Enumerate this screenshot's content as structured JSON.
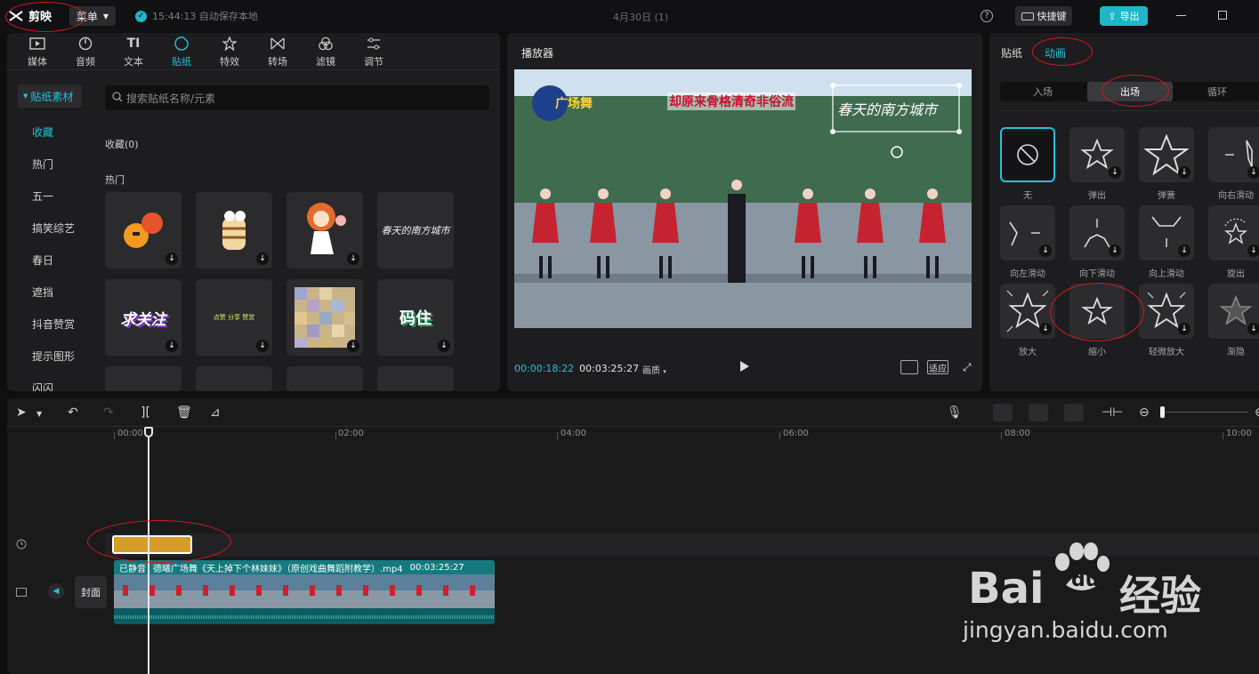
{
  "topbar": {
    "logo_text": "剪映",
    "menu_label": "菜单",
    "save_status": "15:44:13 自动保存本地",
    "doc_title": "4月30日 (1)",
    "shortcut_label": "快捷键",
    "export_label": "导出"
  },
  "media": {
    "tabs": [
      {
        "label": "媒体",
        "icon": "media-icon"
      },
      {
        "label": "音频",
        "icon": "audio-icon"
      },
      {
        "label": "文本",
        "icon": "text-icon"
      },
      {
        "label": "贴纸",
        "icon": "sticker-icon"
      },
      {
        "label": "特效",
        "icon": "effects-icon"
      },
      {
        "label": "转场",
        "icon": "transition-icon"
      },
      {
        "label": "滤镜",
        "icon": "filter-icon"
      },
      {
        "label": "调节",
        "icon": "adjust-icon"
      }
    ],
    "category_header": "贴纸素材",
    "side_items": [
      "收藏",
      "热门",
      "五一",
      "搞笑综艺",
      "春日",
      "遮挡",
      "抖音赞赏",
      "提示图形",
      "闪闪"
    ],
    "search_placeholder": "搜索贴纸名称/元素",
    "favorites_label": "收藏(0)",
    "hot_label": "热门",
    "sticker_texts": [
      "春天的南方城市",
      "求关注",
      "点赞 分享 赞赏",
      "码住"
    ]
  },
  "player": {
    "title": "播放器",
    "current_time": "00:00:18:22",
    "total_time": "00:03:25:27",
    "quality_label": "画质",
    "fit_label": "适应",
    "video_banner": "却原来骨格清奇非俗流",
    "video_sticker": "春天的南方城市",
    "video_logo": "广场舞"
  },
  "properties": {
    "tabs": [
      "贴纸",
      "动画"
    ],
    "segments": [
      "入场",
      "出场",
      "循环"
    ],
    "animations": [
      {
        "label": "无",
        "icon": "none-icon"
      },
      {
        "label": "弹出",
        "icon": "star-icon"
      },
      {
        "label": "弹簧",
        "icon": "star-icon"
      },
      {
        "label": "向右滑动",
        "icon": "star-icon"
      },
      {
        "label": "向左滑动",
        "icon": "star-icon"
      },
      {
        "label": "向下滑动",
        "icon": "star-icon"
      },
      {
        "label": "向上滑动",
        "icon": "star-icon"
      },
      {
        "label": "旋出",
        "icon": "star-icon"
      },
      {
        "label": "放大",
        "icon": "star-icon"
      },
      {
        "label": "缩小",
        "icon": "star-icon"
      },
      {
        "label": "轻微放大",
        "icon": "star-icon"
      },
      {
        "label": "渐隐",
        "icon": "star-icon"
      }
    ]
  },
  "timeline": {
    "ruler": [
      "00:00",
      "02:00",
      "04:00",
      "06:00",
      "08:00",
      "10:00"
    ],
    "clip_muted": "已静音",
    "clip_name": "德曦广场舞《天上掉下个林妹妹》（原创戏曲舞蹈附教学）.mp4",
    "clip_duration": "00:03:25:27",
    "cover_label": "封面"
  },
  "watermark": {
    "brand": "Bai",
    "brand2": "du",
    "cn": "经验",
    "url": "jingyan.baidu.com"
  },
  "colors": {
    "accent": "#21c4d8",
    "sticker_clip": "#d89c2a",
    "video_clip": "#0f6e74",
    "annotation": "#d21a1a"
  }
}
